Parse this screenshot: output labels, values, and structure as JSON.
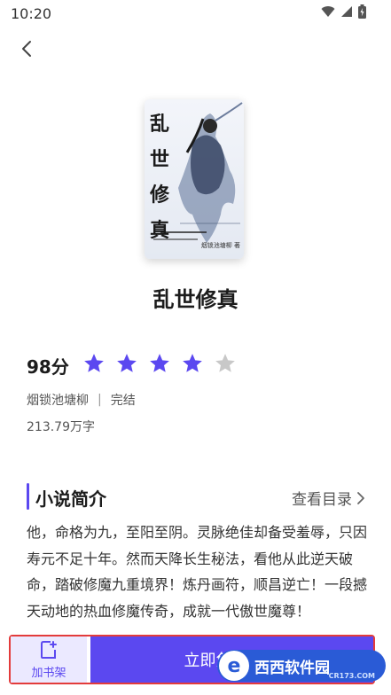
{
  "status_bar": {
    "time": "10:20"
  },
  "book": {
    "cover_title_chars": [
      "乱",
      "世",
      "修",
      "真"
    ],
    "cover_author": "烟锁池塘柳 著",
    "title": "乱世修真",
    "score": "98分",
    "rating": 4,
    "rating_max": 5,
    "author": "烟锁池塘柳",
    "status": "完结",
    "word_count": "213.79万字"
  },
  "section": {
    "title": "小说简介",
    "catalog_label": "查看目录"
  },
  "intro": "他，命格为九，至阳至阴。灵脉绝佳却备受羞辱，只因寿元不足十年。然而天降长生秘法，看他从此逆天破命，踏破修魔九重境界！炼丹画符，顺昌逆亡！一段撼天动地的热血修魔传奇，成就一代傲世魔尊！",
  "bottom": {
    "shelf_label": "加书架",
    "read_label": "立即免费阅读"
  },
  "watermark": {
    "text": "西西软件园",
    "site": "CR173.COM"
  },
  "colors": {
    "accent": "#5b48f0",
    "star_on": "#5b48f0",
    "star_off": "#c8c8c8"
  }
}
